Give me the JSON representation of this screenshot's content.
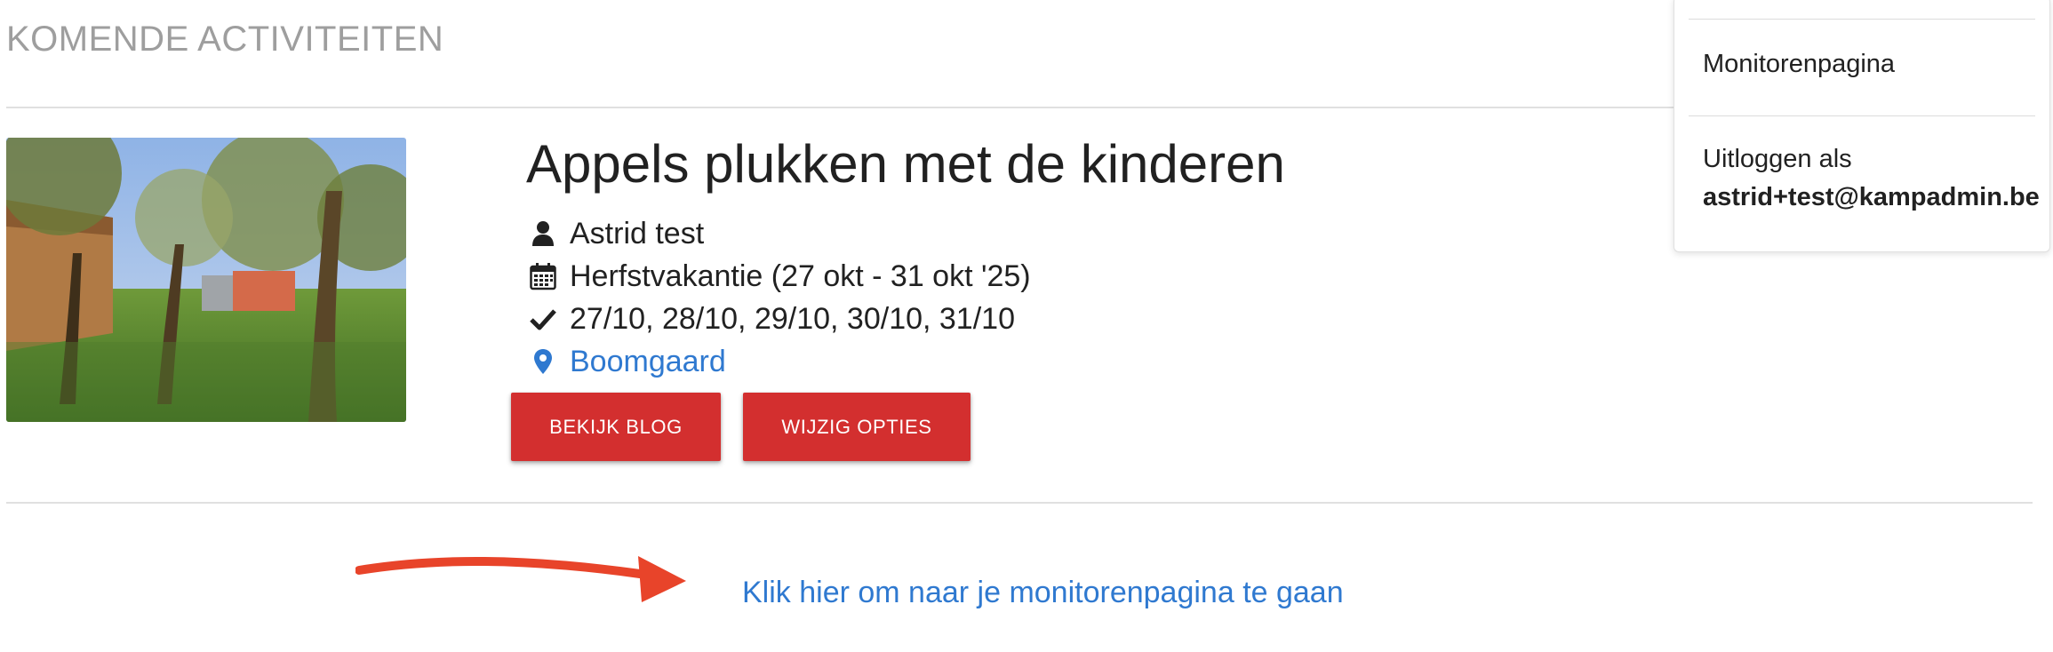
{
  "section": {
    "title": "KOMENDE ACTIVITEITEN"
  },
  "activity": {
    "title": "Appels plukken met de kinderen",
    "image_icon": "orchard-photo",
    "person": {
      "icon": "user-icon",
      "text": "Astrid test"
    },
    "period": {
      "icon": "calendar-icon",
      "text": "Herfstvakantie (27 okt - 31 okt '25)"
    },
    "dates": {
      "icon": "check-icon",
      "text": "27/10, 28/10, 29/10, 30/10, 31/10"
    },
    "location": {
      "icon": "map-pin-icon",
      "text": "Boomgaard"
    },
    "buttons": {
      "blog": "BEKIJK BLOG",
      "options": "WIJZIG OPTIES"
    }
  },
  "monitor_link": "Klik hier om naar je monitorenpagina te gaan",
  "dropdown": {
    "items": [
      {
        "label": "Monitorenpagina"
      },
      {
        "label": "Uitloggen als",
        "email": "astrid+test@kampadmin.be"
      }
    ]
  },
  "colors": {
    "accent_red": "#d32f2f",
    "link_blue": "#2f79d0",
    "arrow_red": "#e8442a",
    "muted_text": "#9e9e9e"
  }
}
